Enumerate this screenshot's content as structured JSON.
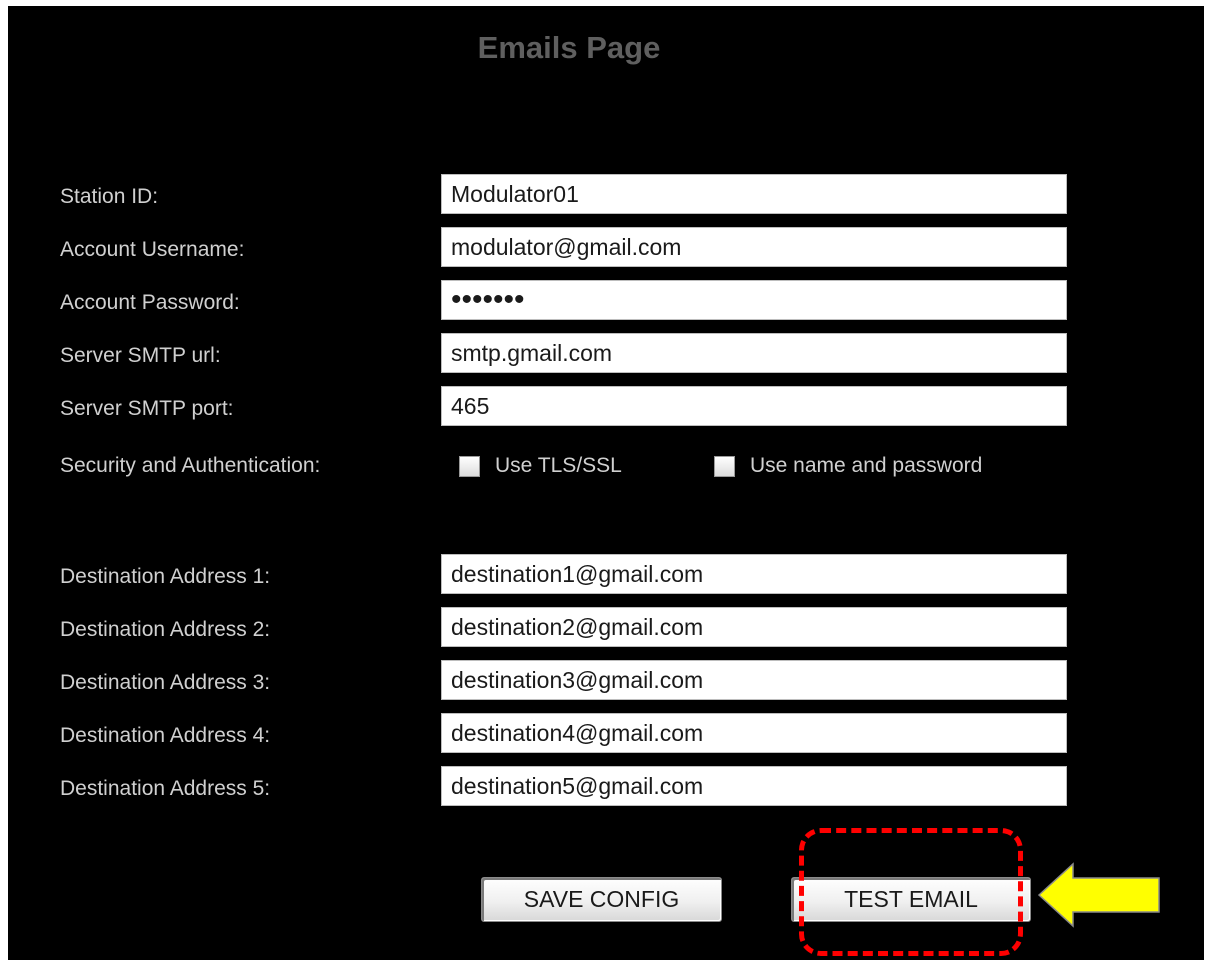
{
  "page": {
    "title": "Emails Page"
  },
  "form": {
    "station_id": {
      "label": "Station ID:",
      "value": "Modulator01"
    },
    "account_username": {
      "label": "Account Username:",
      "value": "modulator@gmail.com"
    },
    "account_password": {
      "label": "Account Password:",
      "value": "•••••••"
    },
    "server_smtp_url": {
      "label": "Server SMTP url:",
      "value": "smtp.gmail.com"
    },
    "server_smtp_port": {
      "label": "Server SMTP port:",
      "value": "465"
    },
    "security": {
      "label": "Security and Authentication:",
      "use_tls_ssl": {
        "label": "Use TLS/SSL",
        "checked": false
      },
      "use_name_password": {
        "label": "Use name and password",
        "checked": false
      }
    },
    "destinations": [
      {
        "label": "Destination Address 1:",
        "value": "destination1@gmail.com"
      },
      {
        "label": "Destination Address 2:",
        "value": "destination2@gmail.com"
      },
      {
        "label": "Destination Address 3:",
        "value": "destination3@gmail.com"
      },
      {
        "label": "Destination Address 4:",
        "value": "destination4@gmail.com"
      },
      {
        "label": "Destination Address 5:",
        "value": "destination5@gmail.com"
      }
    ]
  },
  "buttons": {
    "save_config": "SAVE CONFIG",
    "test_email": "TEST EMAIL"
  },
  "annotation": {
    "highlight_color": "#ff0000",
    "arrow_color": "#ffff00",
    "arrow_icon": "arrow-left-icon"
  }
}
